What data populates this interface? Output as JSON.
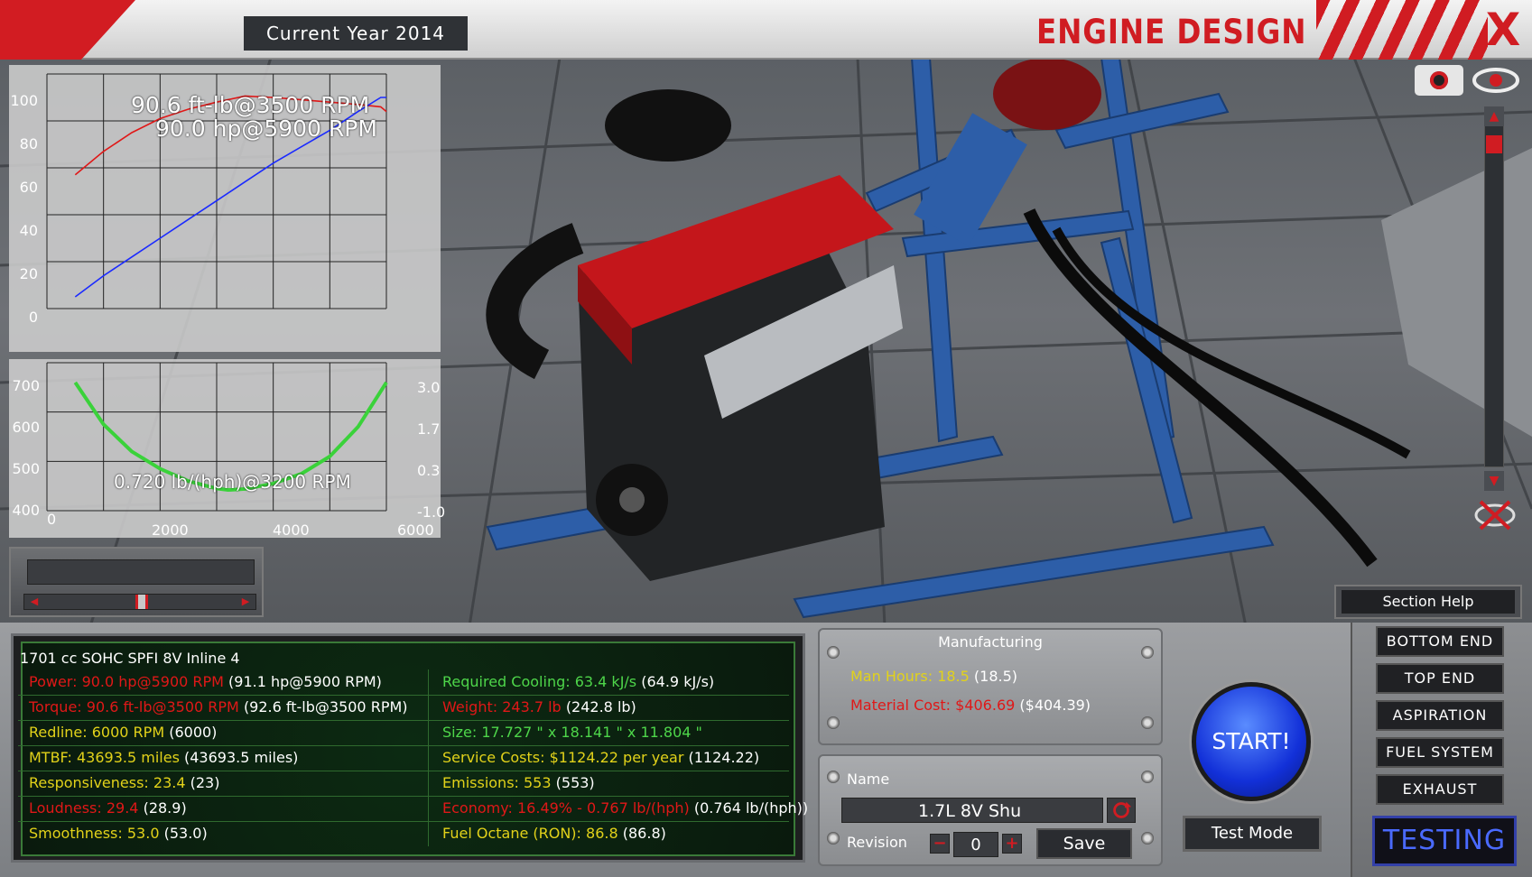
{
  "header": {
    "year_label": "Current Year 2014",
    "title": "ENGINE DESIGN",
    "close_label": "X"
  },
  "graphs": {
    "power_torque_peak_torque": "90.6 ft-lb@3500 RPM",
    "power_torque_peak_power": "90.0 hp@5900 RPM",
    "bsfc_label": "0.720 lb/(hph)@3200 RPM",
    "top_yticks": [
      "100",
      "80",
      "60",
      "40",
      "20",
      "0"
    ],
    "bottom_left_yticks": [
      "700",
      "600",
      "500",
      "400"
    ],
    "bottom_right_yticks": [
      "3.0",
      "1.7",
      "0.3",
      "-1.0"
    ],
    "xticks": [
      "0",
      "2000",
      "4000",
      "6000"
    ]
  },
  "chart_data": [
    {
      "type": "line",
      "x": [
        500,
        1000,
        1500,
        2000,
        2500,
        3000,
        3500,
        4000,
        4500,
        5000,
        5500,
        5900,
        6000
      ],
      "series": [
        {
          "color": "#e01818",
          "values": [
            57,
            67,
            75,
            81,
            85,
            88,
            90.6,
            90,
            89,
            88,
            87,
            86,
            84
          ]
        },
        {
          "color": "#1a2aff",
          "values": [
            5,
            14,
            22,
            30,
            38,
            46,
            54,
            62,
            69,
            76,
            84,
            90,
            90
          ]
        }
      ],
      "xlim": [
        0,
        6000
      ],
      "ylim": [
        0,
        100
      ]
    },
    {
      "type": "line",
      "x": [
        500,
        1000,
        1500,
        2000,
        2500,
        3000,
        3200,
        3500,
        4000,
        4500,
        5000,
        5500,
        6000
      ],
      "series": [
        {
          "color": "#3ad23a",
          "values": [
            660,
            575,
            520,
            485,
            460,
            445,
            442,
            444,
            455,
            475,
            510,
            570,
            660
          ]
        }
      ],
      "xlim": [
        0,
        6000
      ],
      "ylim": [
        400,
        700
      ]
    }
  ],
  "stats": {
    "engine_summary": "1701 cc SOHC SPFI 8V Inline 4",
    "left": [
      {
        "key": "Power: 90.0 hp@5900 RPM",
        "val": "(91.1 hp@5900 RPM)",
        "color": "red"
      },
      {
        "key": "Torque: 90.6 ft-lb@3500 RPM",
        "val": "(92.6 ft-lb@3500 RPM)",
        "color": "red"
      },
      {
        "key": "Redline: 6000 RPM",
        "val": "(6000)",
        "color": "yel"
      },
      {
        "key": "MTBF: 43693.5 miles",
        "val": "(43693.5 miles)",
        "color": "yel"
      },
      {
        "key": "Responsiveness: 23.4",
        "val": "(23)",
        "color": "yel"
      },
      {
        "key": "Loudness: 29.4",
        "val": "(28.9)",
        "color": "red"
      },
      {
        "key": "Smoothness: 53.0",
        "val": "(53.0)",
        "color": "yel"
      }
    ],
    "right": [
      {
        "key": "Required Cooling: 63.4 kJ/s",
        "val": "(64.9 kJ/s)",
        "color": "grn"
      },
      {
        "key": "Weight: 243.7 lb",
        "val": "(242.8 lb)",
        "color": "red"
      },
      {
        "key": "Size: 17.727 \" x 18.141 \" x 11.804 \"",
        "val": "",
        "color": "grn"
      },
      {
        "key": "Service Costs: $1124.22 per year",
        "val": "(1124.22)",
        "color": "yel"
      },
      {
        "key": "Emissions: 553",
        "val": "(553)",
        "color": "yel"
      },
      {
        "key": "Economy: 16.49% - 0.767 lb/(hph)",
        "val": "(0.764 lb/(hph))",
        "color": "red"
      },
      {
        "key": "Fuel Octane (RON): 86.8",
        "val": "(86.8)",
        "color": "yel"
      }
    ]
  },
  "manufacturing": {
    "title": "Manufacturing",
    "man_hours_key": "Man Hours: 18.5",
    "man_hours_val": "(18.5)",
    "material_cost_key": "Material Cost: $406.69",
    "material_cost_val": "($404.39)"
  },
  "naming": {
    "name_label": "Name",
    "name_value": "1.7L 8V Shu",
    "revision_label": "Revision",
    "revision_value": "0",
    "save_label": "Save"
  },
  "actions": {
    "start_label": "START!",
    "test_mode_label": "Test Mode",
    "section_help_label": "Section Help"
  },
  "nav": {
    "items": [
      "BOTTOM END",
      "TOP END",
      "ASPIRATION",
      "FUEL SYSTEM",
      "EXHAUST"
    ],
    "active": "TESTING"
  },
  "colors": {
    "accent_red": "#d01c22",
    "stat_red": "#e01818",
    "stat_yellow": "#e2d21a",
    "stat_green": "#4ed64a",
    "start_blue": "#1230d8"
  }
}
